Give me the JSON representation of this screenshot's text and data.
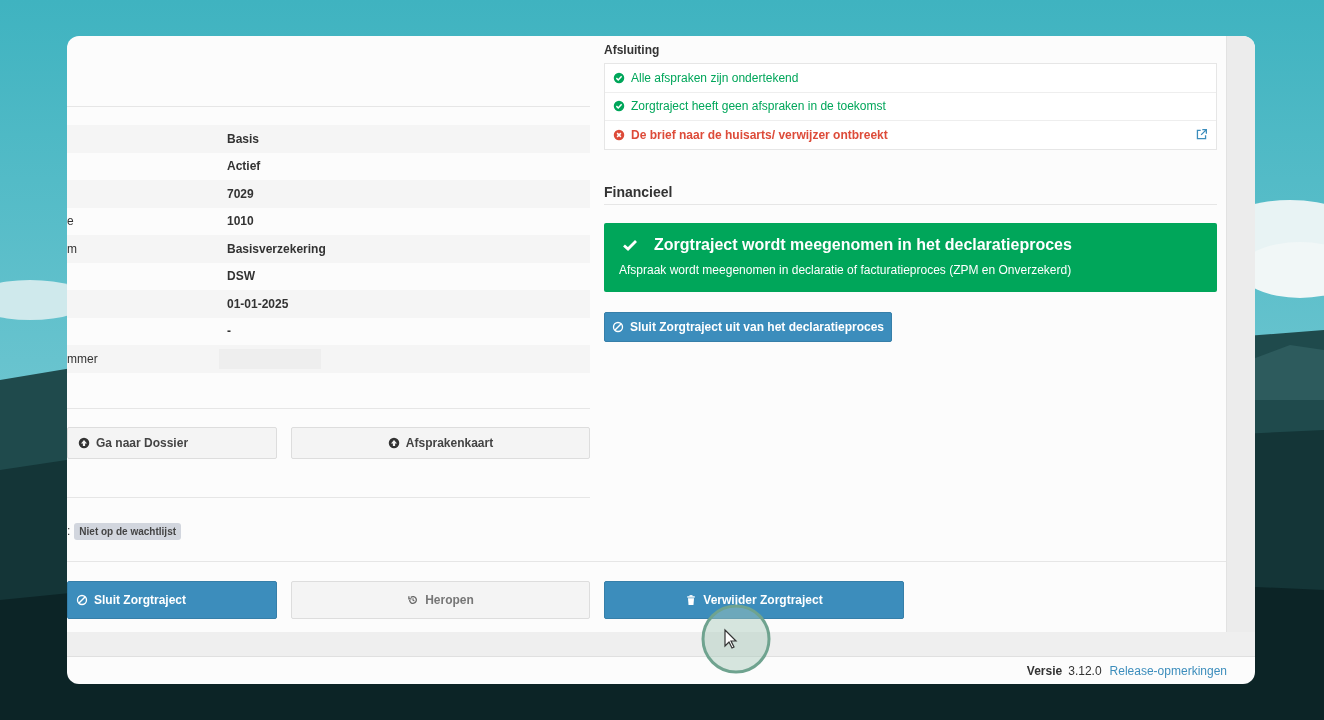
{
  "details": {
    "rows": [
      {
        "value": "Basis"
      },
      {
        "value": "Actief"
      },
      {
        "value": "7029"
      },
      {
        "label": "e",
        "value": "1010"
      },
      {
        "label": "m",
        "value": "Basisverzekering"
      },
      {
        "value": "DSW"
      },
      {
        "value": "01-01-2025"
      },
      {
        "value": "-"
      },
      {
        "label": "mmer",
        "kind": "blank"
      }
    ]
  },
  "links": [
    {
      "label": "Ga naar Dossier"
    },
    {
      "label": "Afsprakenkaart"
    }
  ],
  "waitlist": {
    "label": ":",
    "badge": "Niet op de wachtlijst"
  },
  "closing": {
    "title": "Afsluiting",
    "checks": [
      {
        "text": "Alle afspraken zijn ondertekend",
        "passed": true,
        "link": false
      },
      {
        "text": "Zorgtraject heeft geen afspraken in de toekomst",
        "passed": true,
        "link": false
      },
      {
        "text": "De brief naar de huisarts/ verwijzer ontbreekt",
        "passed": false,
        "link": true
      }
    ]
  },
  "financial": {
    "title": "Financieel",
    "alert": {
      "title": "Zorgtraject wordt meegenomen in het declaratieproces",
      "text": "Afspraak wordt meegenomen in declaratie of facturatieproces (ZPM en Onverzekerd)"
    },
    "button": "Sluit Zorgtraject uit van het declaratieproces"
  },
  "actions": [
    {
      "label": "Sluit Zorgtraject",
      "kind": "close",
      "disabled": false
    },
    {
      "label": "Heropen",
      "kind": "reopen",
      "disabled": true
    },
    {
      "label": "Verwijder Zorgtraject",
      "kind": "delete",
      "disabled": false
    }
  ],
  "footer": {
    "version_label": "Versie",
    "version": "3.12.0",
    "link": "Release-opmerkingen"
  }
}
